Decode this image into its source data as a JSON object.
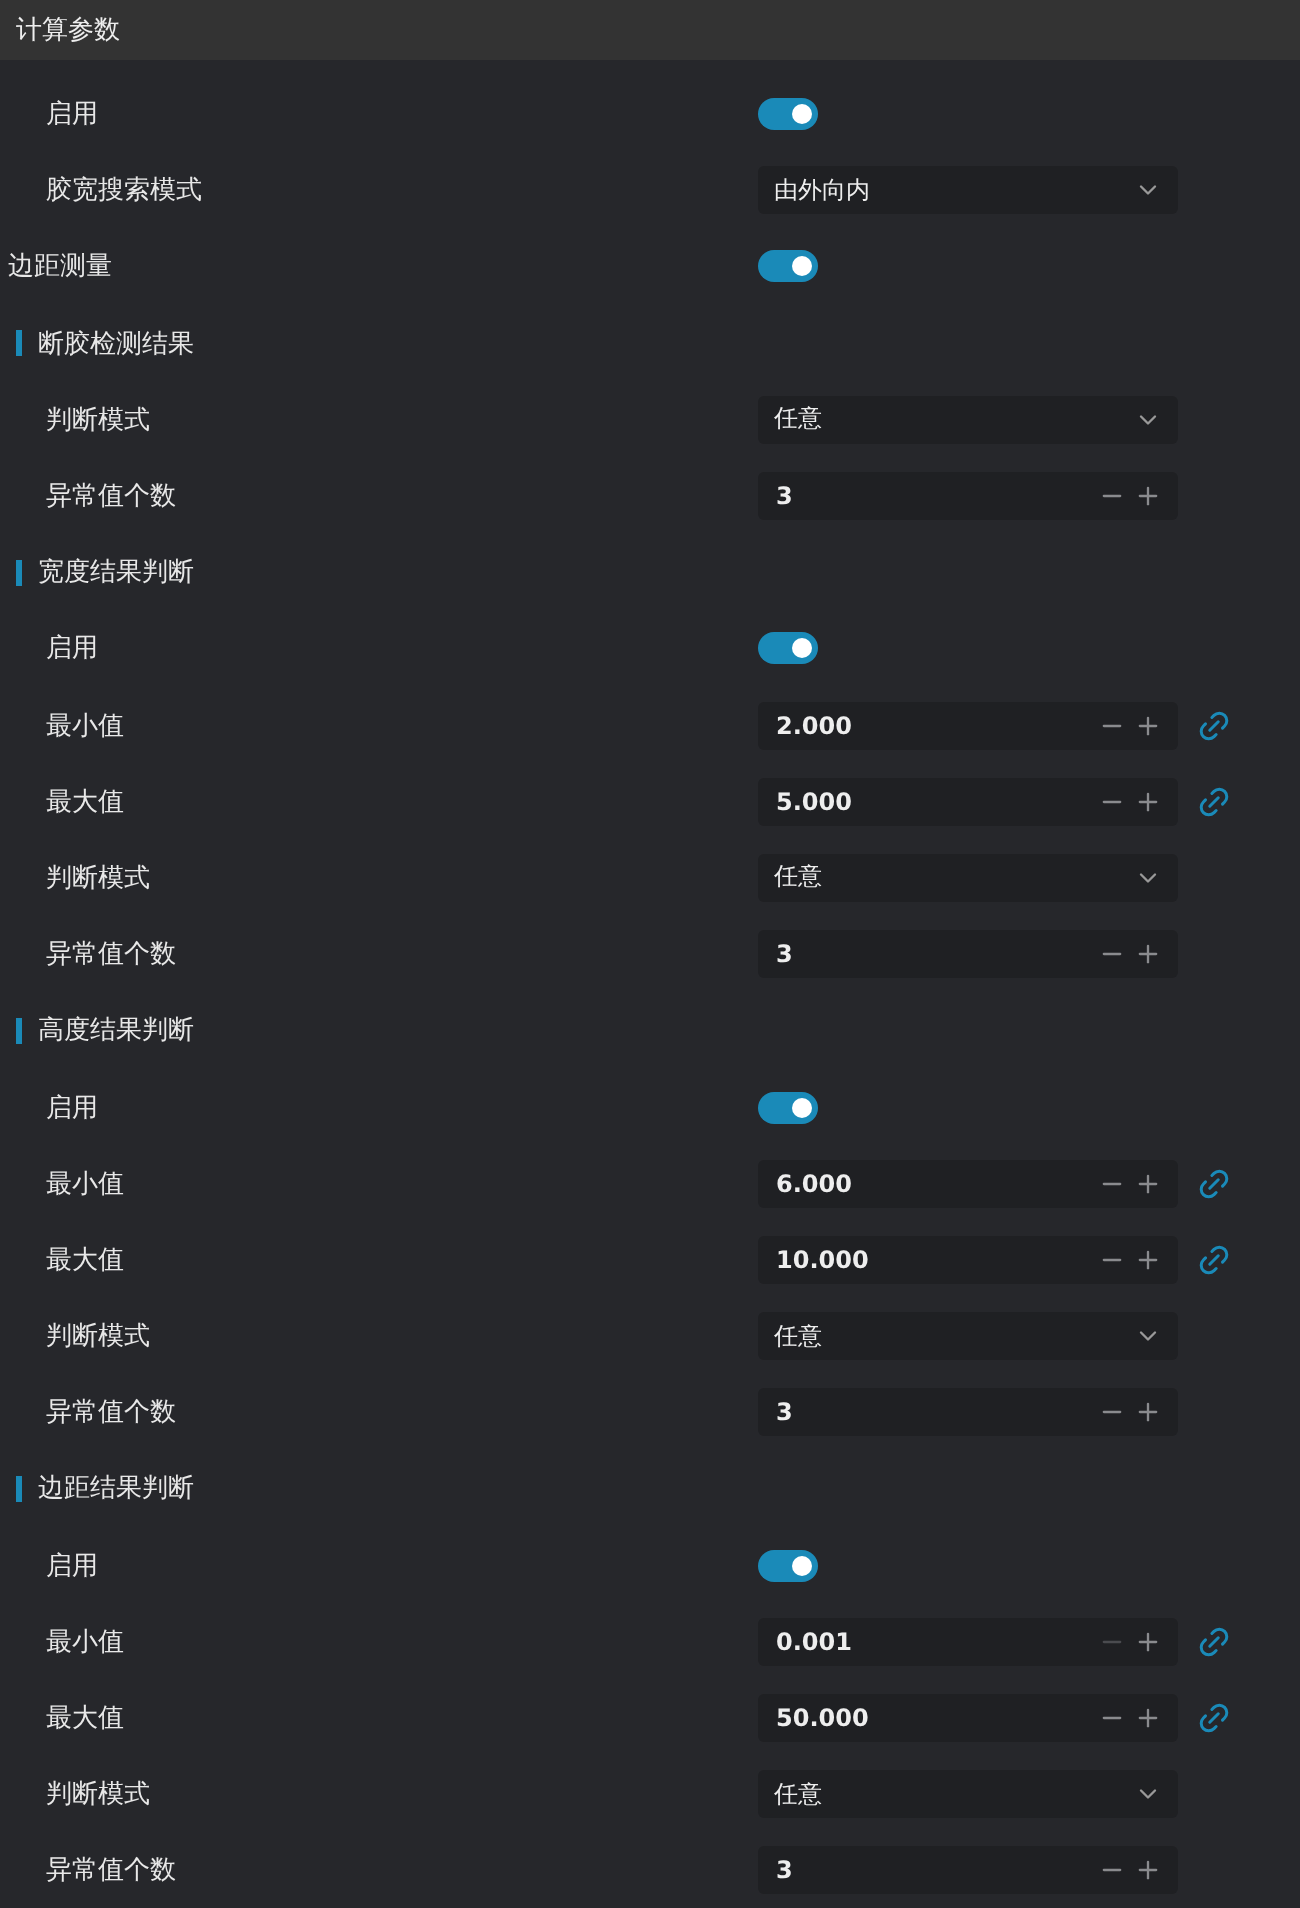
{
  "header": "计算参数",
  "rows": [
    {
      "kind": "toggle",
      "label": "启用",
      "on": true
    },
    {
      "kind": "select",
      "label": "胶宽搜索模式",
      "value": "由外向内"
    },
    {
      "kind": "heading_toggle",
      "label": "边距测量",
      "on": true
    },
    {
      "kind": "section",
      "label": "断胶检测结果"
    },
    {
      "kind": "select",
      "label": "判断模式",
      "value": "任意"
    },
    {
      "kind": "number",
      "label": "异常值个数",
      "value": "3",
      "minus_disabled": false,
      "linked": false
    },
    {
      "kind": "section",
      "label": "宽度结果判断"
    },
    {
      "kind": "toggle",
      "label": "启用",
      "on": true
    },
    {
      "kind": "number",
      "label": "最小值",
      "value": "2.000",
      "minus_disabled": false,
      "linked": true
    },
    {
      "kind": "number",
      "label": "最大值",
      "value": "5.000",
      "minus_disabled": false,
      "linked": true
    },
    {
      "kind": "select",
      "label": "判断模式",
      "value": "任意"
    },
    {
      "kind": "number",
      "label": "异常值个数",
      "value": "3",
      "minus_disabled": false,
      "linked": false
    },
    {
      "kind": "section",
      "label": "高度结果判断"
    },
    {
      "kind": "toggle",
      "label": "启用",
      "on": true
    },
    {
      "kind": "number",
      "label": "最小值",
      "value": "6.000",
      "minus_disabled": false,
      "linked": true
    },
    {
      "kind": "number",
      "label": "最大值",
      "value": "10.000",
      "minus_disabled": false,
      "linked": true
    },
    {
      "kind": "select",
      "label": "判断模式",
      "value": "任意"
    },
    {
      "kind": "number",
      "label": "异常值个数",
      "value": "3",
      "minus_disabled": false,
      "linked": false
    },
    {
      "kind": "section",
      "label": "边距结果判断"
    },
    {
      "kind": "toggle",
      "label": "启用",
      "on": true
    },
    {
      "kind": "number",
      "label": "最小值",
      "value": "0.001",
      "minus_disabled": true,
      "linked": true
    },
    {
      "kind": "number",
      "label": "最大值",
      "value": "50.000",
      "minus_disabled": false,
      "linked": true
    },
    {
      "kind": "select",
      "label": "判断模式",
      "value": "任意"
    },
    {
      "kind": "number",
      "label": "异常值个数",
      "value": "3",
      "minus_disabled": false,
      "linked": false
    }
  ]
}
